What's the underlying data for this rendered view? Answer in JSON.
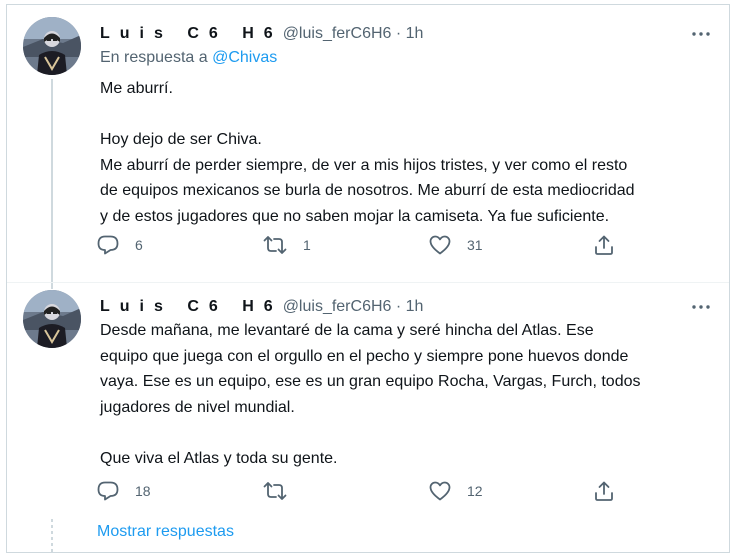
{
  "tweets": [
    {
      "name": "Luis C6 H6",
      "handle": "@luis_ferC6H6 · 1h",
      "reply_prefix": "En respuesta a ",
      "reply_mention": "@Chivas",
      "lines": [
        "Me aburrí.",
        "",
        "Hoy dejo de ser Chiva.",
        "Me aburrí de perder siempre, de ver a mis hijos tristes, y ver como el resto",
        "de equipos mexicanos se burla de nosotros. Me aburrí de esta mediocridad",
        "y de estos jugadores que no saben mojar la camiseta. Ya fue suficiente."
      ],
      "replies": "6",
      "retweets": "1",
      "likes": "31"
    },
    {
      "name": "Luis C6 H6",
      "handle": "@luis_ferC6H6 · 1h",
      "lines": [
        "Desde mañana, me levantaré de la cama y seré hincha del Atlas. Ese",
        "equipo que juega con el orgullo en el pecho y siempre pone huevos donde",
        "vaya. Ese es un equipo, ese es un gran equipo Rocha, Vargas, Furch, todos",
        "jugadores de nivel mundial.",
        "",
        "Que viva el Atlas y toda su gente."
      ],
      "replies": "18",
      "retweets": "",
      "likes": "12"
    }
  ],
  "show_replies": "Mostrar respuestas",
  "icons": {
    "reply": "reply-icon",
    "retweet": "retweet-icon",
    "like": "heart-icon",
    "share": "share-icon",
    "more": "more-icon"
  },
  "colors": {
    "text": "#0f1419",
    "secondary": "#536471",
    "accent": "#1d9bf0",
    "border": "#cfd9de"
  }
}
